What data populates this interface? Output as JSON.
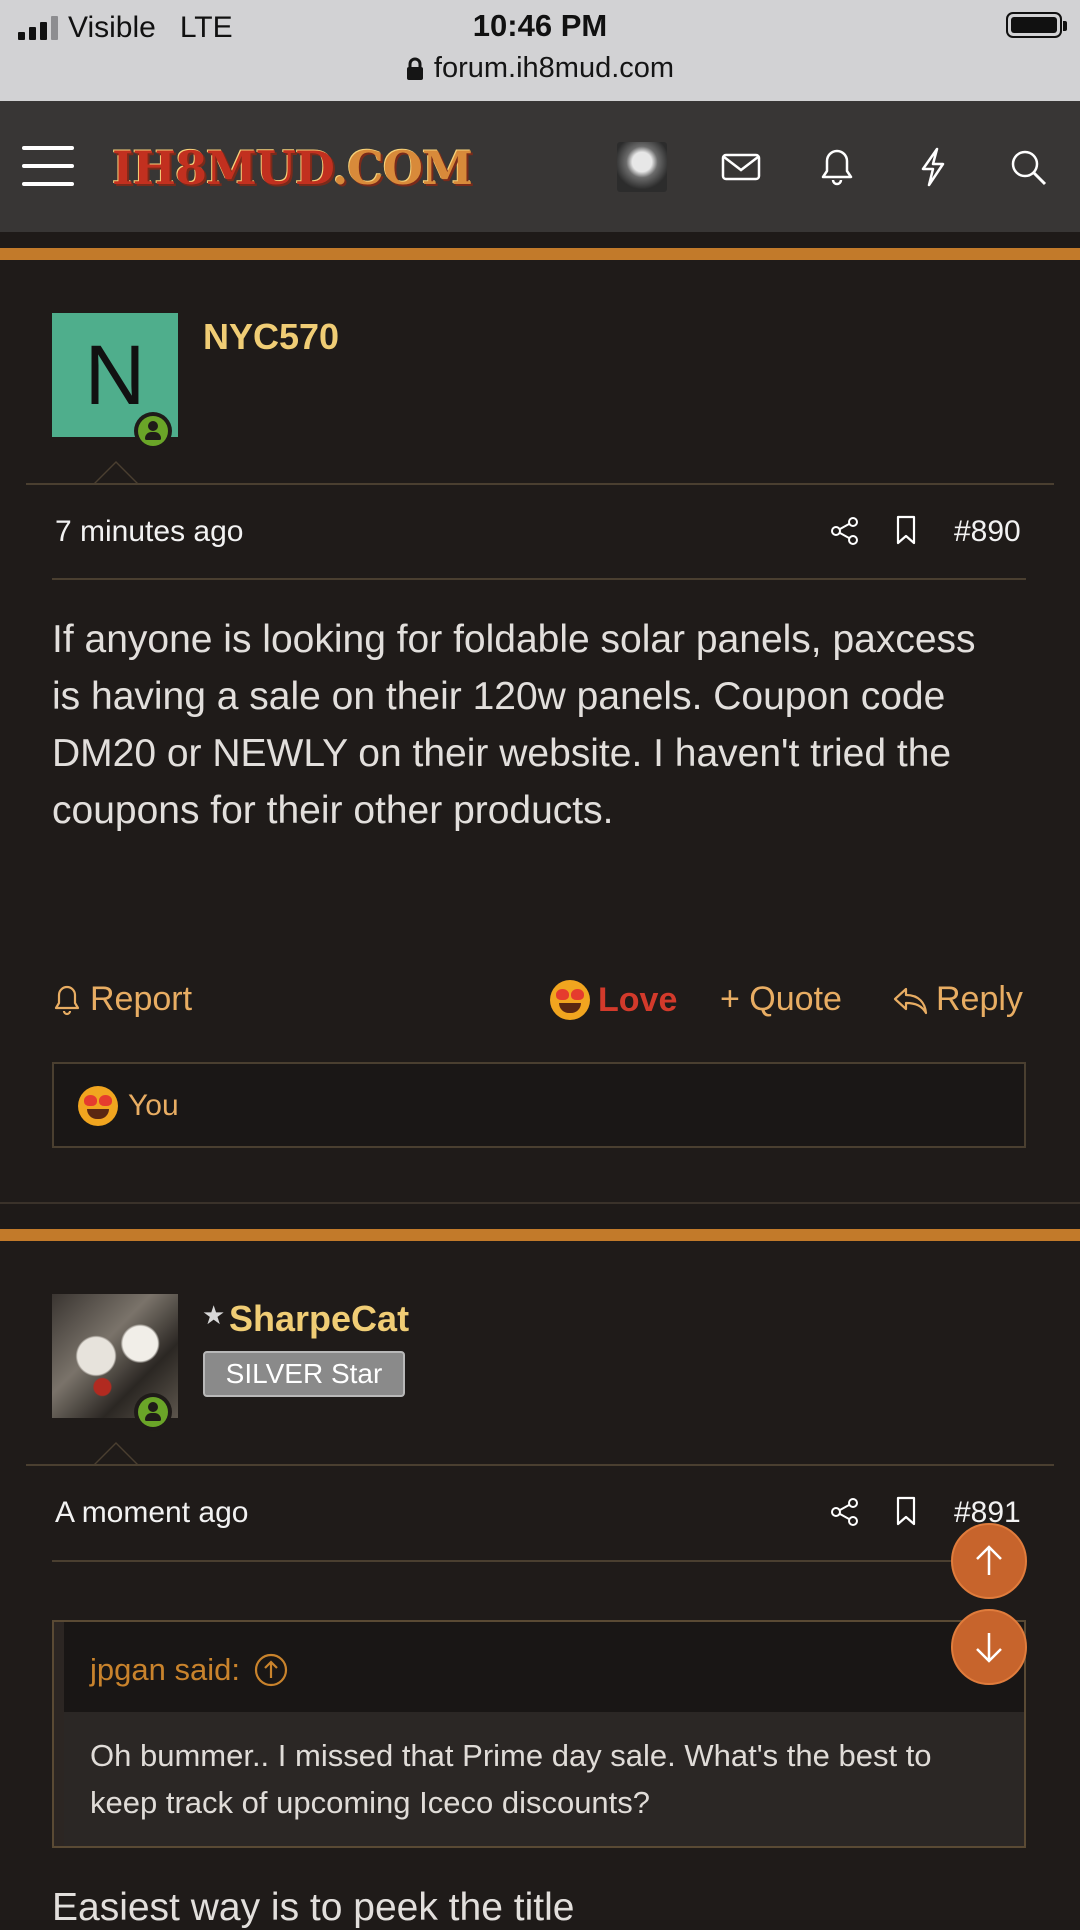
{
  "status_bar": {
    "carrier": "Visible",
    "network": "LTE",
    "time": "10:46 PM",
    "url": "forum.ih8mud.com"
  },
  "header": {
    "logo_text_a": "IH8MUD",
    "logo_text_b": ".COM",
    "icons": [
      "menu-icon",
      "user-avatar",
      "mail-icon",
      "bell-icon",
      "lightning-icon",
      "search-icon"
    ]
  },
  "posts": [
    {
      "avatar_letter": "N",
      "username": "NYC570",
      "time": "7 minutes ago",
      "post_number": "#890",
      "body": "If anyone is looking for foldable solar panels, paxcess is having a sale on their 120w panels. Coupon code DM20 or NEWLY on their website. I haven't tried the coupons for their other products.",
      "actions": {
        "report": "Report",
        "love": "Love",
        "quote": "+ Quote",
        "reply": "Reply"
      },
      "reactions_label": "You"
    },
    {
      "username": "SharpeCat",
      "badge": "SILVER Star",
      "time": "A moment ago",
      "post_number": "#891",
      "quote_author": "jpgan said:",
      "quote_body": "Oh bummer.. I missed that Prime day sale. What's the best to keep track of upcoming Iceco discounts?",
      "body_partial": "Easiest way is to peek the title"
    }
  ],
  "colors": {
    "accent": "#c27a2a",
    "username": "#f0cd75",
    "link": "#e8ad63",
    "love": "#d23a2b",
    "scroll_button": "#c7642c"
  }
}
